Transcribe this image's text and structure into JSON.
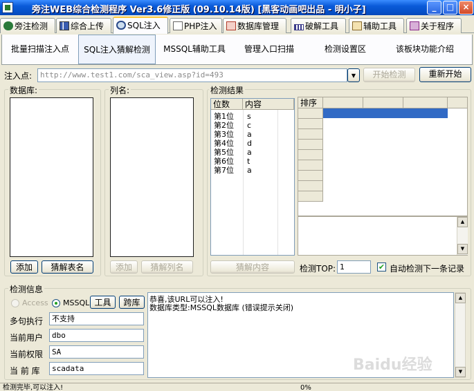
{
  "window": {
    "title": "旁注WEB综合检测程序 Ver3.6修正版 (09.10.14版) [黑客动画吧出品 - 明小子]",
    "min_glyph": "_",
    "max_glyph": "□",
    "close_glyph": "×"
  },
  "tabs": [
    {
      "label": "旁注检测",
      "icon": "globe-icon",
      "color": "#2a7a3a"
    },
    {
      "label": "综合上传",
      "icon": "chart-icon",
      "color": "#3a5cb0"
    },
    {
      "label": "SQL注入",
      "icon": "search-icon",
      "color": "#2a4a8a",
      "active": true
    },
    {
      "label": "PHP注入",
      "icon": "document-icon",
      "color": "#6a6a6a"
    },
    {
      "label": "数据库管理",
      "icon": "database-icon",
      "color": "#b03a2a"
    },
    {
      "label": "破解工具",
      "icon": "keyboard-icon",
      "color": "#3a3a8a"
    },
    {
      "label": "辅助工具",
      "icon": "clipboard-icon",
      "color": "#c08a2a"
    },
    {
      "label": "关于程序",
      "icon": "book-icon",
      "color": "#8a2a8a"
    }
  ],
  "subnav": [
    "批量扫描注入点",
    "SQL注入猜解检测",
    "MSSQL辅助工具",
    "管理入口扫描",
    "检测设置区",
    "该板块功能介绍"
  ],
  "inject": {
    "label": "注入点:",
    "placeholder": "http://www.test1.com/sca_view.asp?id=493",
    "start_btn": "开始检测",
    "restart_btn": "重新开始"
  },
  "db_panel": {
    "title": "数据库:",
    "add_btn": "添加",
    "guess_btn": "猜解表名"
  },
  "col_panel": {
    "title": "列名:",
    "add_btn": "添加",
    "guess_btn": "猜解列名"
  },
  "results": {
    "title": "检测结果",
    "columns": [
      "位数",
      "内容"
    ],
    "rows": [
      {
        "pos": "第1位",
        "val": "s"
      },
      {
        "pos": "第2位",
        "val": "c"
      },
      {
        "pos": "第3位",
        "val": "a"
      },
      {
        "pos": "第4位",
        "val": "d"
      },
      {
        "pos": "第5位",
        "val": "a"
      },
      {
        "pos": "第6位",
        "val": "t"
      },
      {
        "pos": "第7位",
        "val": "a"
      }
    ],
    "guess_btn": "猜解内容",
    "grid_header": "排序",
    "top_label": "检测TOP:",
    "top_value": "1",
    "auto_label": "自动检测下一条记录",
    "auto_checked": true
  },
  "detect": {
    "title": "检测信息",
    "radio_access": "Access",
    "radio_mssql": "MSSQL",
    "selected": "MSSQL",
    "tools_btn": "工具",
    "cross_btn": "跨库",
    "fields": [
      {
        "label": "多句执行",
        "value": "不支持"
      },
      {
        "label": "当前用户",
        "value": "dbo"
      },
      {
        "label": "当前权限",
        "value": "SA"
      },
      {
        "label": "当 前 库",
        "value": "scadata"
      }
    ],
    "messages": [
      "恭喜,该URL可以注入!",
      "数据库类型:MSSQL数据库 (错误提示关闭)"
    ]
  },
  "status": {
    "text": "检测完毕,可以注入!",
    "percent": "0%"
  },
  "watermark": "Baidu经验"
}
